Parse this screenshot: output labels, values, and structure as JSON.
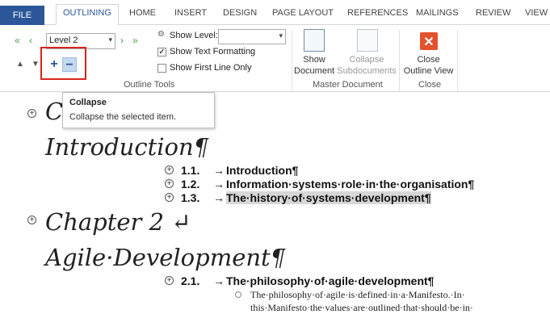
{
  "tabs": [
    "FILE",
    "OUTLINING",
    "HOME",
    "INSERT",
    "DESIGN",
    "PAGE LAYOUT",
    "REFERENCES",
    "MAILINGS",
    "REVIEW",
    "VIEW"
  ],
  "outline_tools": {
    "level": "Level 2",
    "show_level_label": "Show Level:",
    "show_text_formatting_label": "Show Text Formatting",
    "show_text_formatting_checked": true,
    "show_first_line_only_label": "Show First Line Only",
    "show_first_line_only_checked": false,
    "group_label": "Outline Tools"
  },
  "master_document": {
    "show_document_label_1": "Show",
    "show_document_label_2": "Document",
    "collapse_subdocs_label_1": "Collapse",
    "collapse_subdocs_label_2": "Subdocuments",
    "group_label": "Master Document"
  },
  "close_group": {
    "close_label_1": "Close",
    "close_label_2": "Outline View",
    "group_label": "Close"
  },
  "tooltip": {
    "title": "Collapse",
    "description": "Collapse the selected item."
  },
  "document": {
    "chapter1_partial": "C",
    "chapter1_title": "Introduction¶",
    "chapter1_items": [
      {
        "num": "1.1.",
        "arrow": "→",
        "text": "Introduction¶"
      },
      {
        "num": "1.2.",
        "arrow": "→",
        "text": "Information·systems·role·in·the·organisation¶"
      },
      {
        "num": "1.3.",
        "arrow": "→",
        "text": "The·history·of·systems·development¶"
      }
    ],
    "chapter2_heading": "Chapter 2 ↵",
    "chapter2_title": "Agile·Development¶",
    "chapter2_items": [
      {
        "num": "2.1.",
        "arrow": "→",
        "text": "The·philosophy·of·agile·development¶"
      }
    ],
    "body_line_1": "The·philosophy·of·agile·is·defined·in·a·Manifesto.·In·",
    "body_line_2": "this·Manifesto·the·values·are·outlined·that·should·be·in·"
  }
}
